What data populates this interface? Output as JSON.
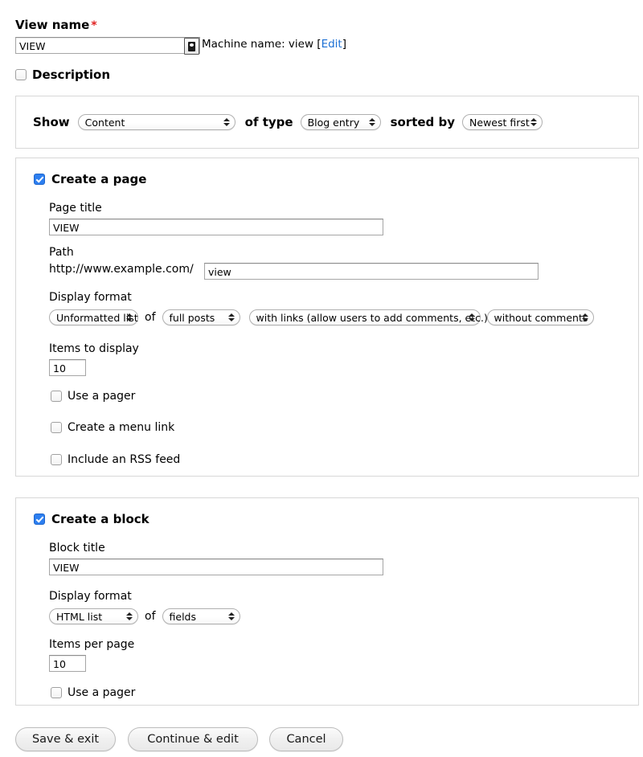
{
  "view_name": {
    "label": "View name",
    "required_marker": "*",
    "value": "VIEW",
    "machine_name_prefix": "Machine name: view [",
    "machine_name_edit": "Edit",
    "machine_name_suffix": "]",
    "widget_icon": "contact-card-icon"
  },
  "description": {
    "label": "Description",
    "checked": false
  },
  "show": {
    "show_label": "Show",
    "base_value": "Content",
    "of_type_label": "of type",
    "type_value": "Blog entry",
    "sorted_by_label": "sorted by",
    "sort_value": "Newest first"
  },
  "page": {
    "title": "Create a page",
    "checked": true,
    "page_title_label": "Page title",
    "page_title_value": "VIEW",
    "path_label": "Path",
    "path_prefix": "http://www.example.com/",
    "path_value": "view",
    "display_format_label": "Display format",
    "format_value": "Unformatted list",
    "of_label": "of",
    "row_value": "full posts",
    "links_value": "with links (allow users to add comments, etc.)",
    "comments_value": "without comments",
    "items_label": "Items to display",
    "items_value": "10",
    "use_pager_label": "Use a pager",
    "use_pager_checked": false,
    "menu_link_label": "Create a menu link",
    "menu_link_checked": false,
    "rss_label": "Include an RSS feed",
    "rss_checked": false
  },
  "block": {
    "title": "Create a block",
    "checked": true,
    "block_title_label": "Block title",
    "block_title_value": "VIEW",
    "display_format_label": "Display format",
    "format_value": "HTML list",
    "of_label": "of",
    "row_value": "fields",
    "items_label": "Items per page",
    "items_value": "10",
    "use_pager_label": "Use a pager",
    "use_pager_checked": false
  },
  "actions": {
    "save_exit": "Save & exit",
    "continue_edit": "Continue & edit",
    "cancel": "Cancel"
  },
  "colors": {
    "link": "#1a6fd4",
    "required": "#e02020",
    "checkbox_on": "#2d7ff0",
    "fieldset_border": "#d7d7d7"
  }
}
